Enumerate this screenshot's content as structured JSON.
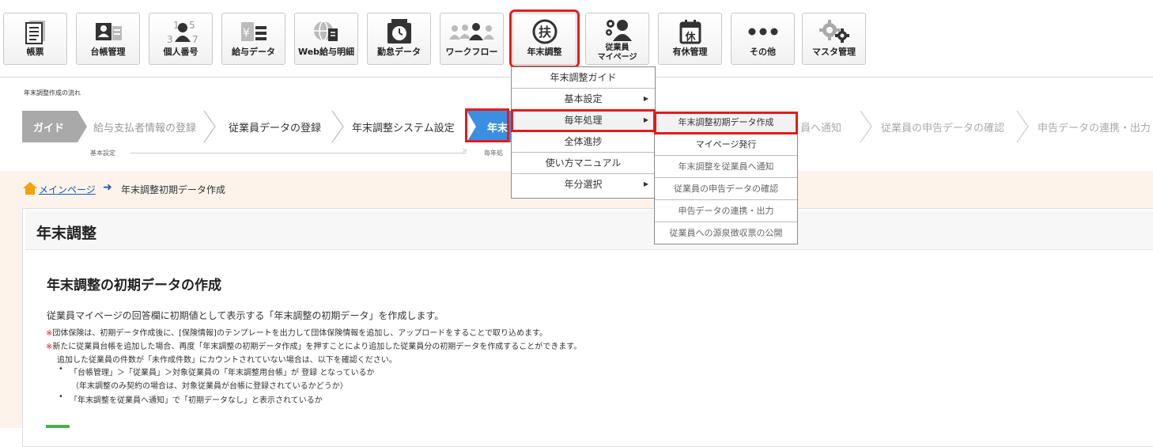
{
  "toolbar": {
    "buttons": [
      {
        "label": "帳票",
        "icon": "report-icon"
      },
      {
        "label": "台帳管理",
        "icon": "ledger-icon"
      },
      {
        "label": "個人番号",
        "icon": "mynumber-icon"
      },
      {
        "label": "給与データ",
        "icon": "salary-data-icon"
      },
      {
        "label": "Web給与明細",
        "icon": "web-payslip-icon"
      },
      {
        "label": "勤怠データ",
        "icon": "attendance-icon"
      },
      {
        "label": "ワークフロー",
        "icon": "workflow-icon"
      },
      {
        "label": "年末調整",
        "icon": "year-end-adjustment-icon",
        "selected": true
      },
      {
        "label": "従業員\nマイページ",
        "line1": "従業員",
        "line2": "マイページ",
        "icon": "employee-mypage-icon"
      },
      {
        "label": "有休管理",
        "icon": "paid-leave-icon"
      },
      {
        "label": "その他",
        "icon": "more-icon"
      },
      {
        "label": "マスタ管理",
        "icon": "master-settings-icon"
      }
    ],
    "highlight_color": "#e21c1c"
  },
  "flow": {
    "title": "年末調整作成の流れ",
    "steps": [
      {
        "label": "ガイド",
        "state": "guide"
      },
      {
        "label": "給与支払者情報の登録",
        "state": "done"
      },
      {
        "label": "従業員データの登録",
        "state": "normal"
      },
      {
        "label": "年末調整システム設定",
        "state": "normal"
      },
      {
        "label": "年末",
        "state": "current"
      },
      {
        "label": "員へ通知",
        "state": "pending"
      },
      {
        "label": "従業員の申告データの確認",
        "state": "pending"
      },
      {
        "label": "申告データの連携・出力",
        "state": "pending"
      }
    ],
    "substeps": {
      "basic": "基本設定",
      "yearly": "毎年処"
    },
    "colors": {
      "guide": "#a9a9a9",
      "current": "#3b8fe0"
    }
  },
  "breadcrumb": {
    "home": "メインページ",
    "current": "年末調整初期データ作成"
  },
  "main": {
    "panel_title": "年末調整",
    "section_title": "年末調整の初期データの作成",
    "description": "従業員マイページの回答欄に初期値として表示する「年末調整の初期データ」を作成します。",
    "note_mark": "※",
    "note1": "団体保険は、初期データ作成後に、[保険情報]のテンプレートを出力して団体保険情報を追加し、アップロードをすることで取り込めます。",
    "note2": "新たに従業員台帳を追加した場合、再度「年末調整の初期データ作成」を押すことにより追加した従業員分の初期データを作成することができます。",
    "note2_sub": "追加した従業員の件数が「未作成件数」にカウントされていない場合は、以下を確認ください。",
    "bullet1": "「台帳管理」＞「従業員」＞対象従業員の「年末調整用台帳」が 登録 となっているか",
    "bullet1_sub": "（年末調整のみ契約の場合は、対象従業員が台帳に登録されているかどうか）",
    "bullet2": "「年末調整を従業員へ通知」で「初期データなし」と表示されているか"
  },
  "dropdown": {
    "items": [
      {
        "label": "年末調整ガイド"
      },
      {
        "label": "基本設定",
        "has_sub": true
      },
      {
        "label": "毎年処理",
        "has_sub": true,
        "highlighted": true
      },
      {
        "label": "全体進捗"
      },
      {
        "label": "使い方マニュアル"
      },
      {
        "label": "年分選択",
        "has_sub": true
      }
    ],
    "arrow": "▶"
  },
  "submenu": {
    "items": [
      {
        "label": "年末調整初期データ作成",
        "highlighted": true
      },
      {
        "label": "マイページ発行"
      },
      {
        "label": "年末調整を従業員へ通知"
      },
      {
        "label": "従業員の申告データの確認"
      },
      {
        "label": "申告データの連携・出力"
      },
      {
        "label": "従業員への源泉徴収票の公開"
      }
    ]
  }
}
